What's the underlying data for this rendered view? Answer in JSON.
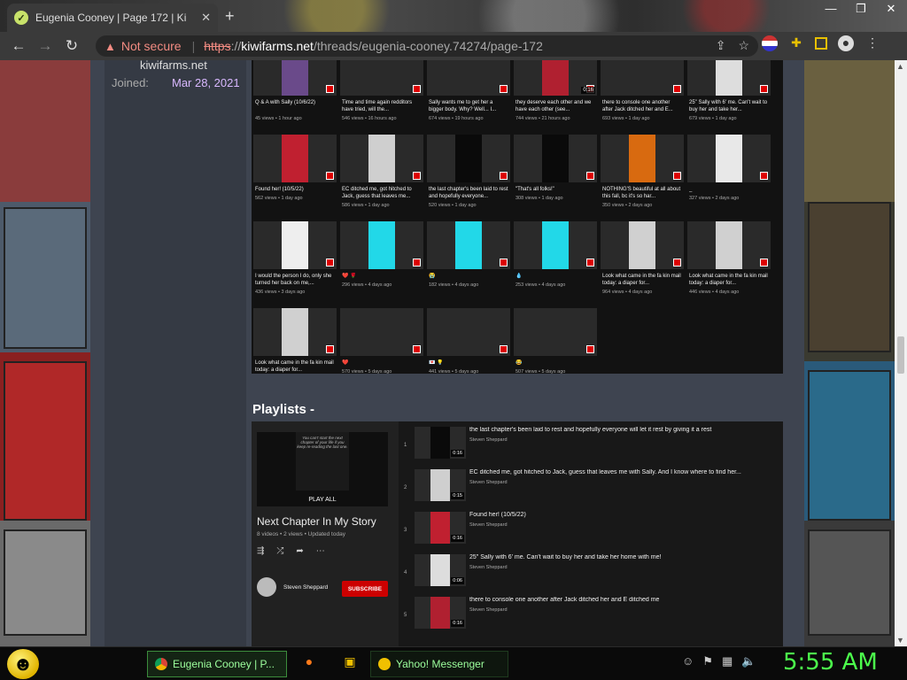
{
  "browser": {
    "tab_title": "Eugenia Cooney | Page 172 | Kiwi",
    "tab_close": "✕",
    "new_tab": "+",
    "window_controls": [
      "—",
      "❐",
      "✕"
    ],
    "nav": {
      "back": "←",
      "forward": "→",
      "reload": "↻"
    },
    "security_label": "Not secure",
    "url_scheme": "https",
    "url_sep": "://",
    "url_host": "kiwifarms.net",
    "url_path": "/threads/eugenia-cooney.74274/page-172"
  },
  "forum": {
    "site_name": "kiwifarms.net",
    "joined_label": "Joined:",
    "joined_date": "Mar 28, 2021"
  },
  "videos": [
    {
      "title": "Q & A with Sally (10/6/22)",
      "meta": "45 views • 1 hour ago",
      "thumb": "#6a4a8a"
    },
    {
      "title": "Time and time again redditors have tried, will the...",
      "meta": "546 views • 16 hours ago",
      "thumb": "#2a2a2a"
    },
    {
      "title": "Sally wants me to get her a bigger body. Why? Well... I...",
      "meta": "674 views • 19 hours ago",
      "thumb": "#2a2a2a"
    },
    {
      "title": "they deserve each other and we have each other (see...",
      "meta": "744 views • 21 hours ago",
      "thumb": "#b02030",
      "dur": "0:16"
    },
    {
      "title": "there to console one another after Jack ditched her and E...",
      "meta": "693 views • 1 day ago",
      "thumb": "#2a2a2a"
    },
    {
      "title": "25\" Sally with 6' me. Can't wait to buy her and take her...",
      "meta": "679 views • 1 day ago",
      "thumb": "#dddddd"
    },
    {
      "title": "Found her! (10/5/22)",
      "meta": "562 views • 1 day ago",
      "thumb": "#c02030"
    },
    {
      "title": "EC ditched me, got hitched to Jack, guess that leaves me...",
      "meta": "586 views • 1 day ago",
      "thumb": "#cfcfcf"
    },
    {
      "title": "the last chapter's been laid to rest and hopefully everyone...",
      "meta": "520 views • 1 day ago",
      "thumb": "#0a0a0a"
    },
    {
      "title": "\"That's all folks!\"",
      "meta": "308 views • 1 day ago",
      "thumb": "#0a0a0a"
    },
    {
      "title": "NOTHING'S beautiful at all about this fall, bc it's so har...",
      "meta": "350 views • 2 days ago",
      "thumb": "#d86a10"
    },
    {
      "title": "_",
      "meta": "327 views • 2 days ago",
      "thumb": "#e8e8e8"
    },
    {
      "title": "I would the person I do, only she turned her back on me,...",
      "meta": "436 views • 3 days ago",
      "thumb": "#eeeeee"
    },
    {
      "title": "❤️ 🌹",
      "meta": "296 views • 4 days ago",
      "thumb": "#22d8e8"
    },
    {
      "title": "😭",
      "meta": "182 views • 4 days ago",
      "thumb": "#22d8e8"
    },
    {
      "title": "💧",
      "meta": "253 views • 4 days ago",
      "thumb": "#22d8e8"
    },
    {
      "title": "Look what came in the fa kin mail today: a diaper for...",
      "meta": "964 views • 4 days ago",
      "thumb": "#d0d0d0"
    },
    {
      "title": "Look what came in the fa kin mail today: a diaper for...",
      "meta": "446 views • 4 days ago",
      "thumb": "#d0d0d0"
    },
    {
      "title": "Look what came in the fa kin mail today: a diaper for...",
      "meta": "487 views • 4 days ago",
      "thumb": "#d0d0d0"
    },
    {
      "title": "❤️",
      "meta": "570 views • 5 days ago",
      "thumb": "#2a2a2a"
    },
    {
      "title": "💌 💡",
      "meta": "441 views • 5 days ago",
      "thumb": "#2a2a2a"
    },
    {
      "title": "😂",
      "meta": "507 views • 5 days ago",
      "thumb": "#2a2a2a"
    }
  ],
  "playlists": {
    "heading": "Playlists -",
    "cover_text": "You can't start the next chapter of your life if you keep re-reading the last one.",
    "play_all": "PLAY ALL",
    "name": "Next Chapter In My Story",
    "meta": "8 videos • 2 views • Updated today",
    "actions": [
      "⇶",
      "⤮",
      "➦",
      "⋯"
    ],
    "channel": "Steven Sheppard",
    "subscribe": "SUBSCRIBE",
    "items": [
      {
        "index": "1",
        "title": "the last chapter's been laid to rest and hopefully everyone will let it rest by giving it a rest",
        "channel": "Steven Sheppard",
        "dur": "0:16",
        "thumb": "#0a0a0a"
      },
      {
        "index": "2",
        "title": "EC ditched me, got hitched to Jack, guess that leaves me with Sally. And I know where to find her...",
        "channel": "Steven Sheppard",
        "dur": "0:15",
        "thumb": "#cfcfcf"
      },
      {
        "index": "3",
        "title": "Found her! (10/5/22)",
        "channel": "Steven Sheppard",
        "dur": "0:16",
        "thumb": "#c02030"
      },
      {
        "index": "4",
        "title": "25\" Sally with 6' me. Can't wait to buy her and take her home with me!",
        "channel": "Steven Sheppard",
        "dur": "0:06",
        "thumb": "#dddddd"
      },
      {
        "index": "5",
        "title": "there to console one another after Jack ditched her and E ditched me",
        "channel": "Steven Sheppard",
        "dur": "0:16",
        "thumb": "#b02030"
      }
    ]
  },
  "taskbar": {
    "tasks": [
      "Eugenia Cooney | P...",
      "Yahoo! Messenger"
    ],
    "clock": "5:55 AM"
  },
  "colors": {
    "accent_green": "#4cff4c",
    "subscribe_red": "#cc0000",
    "insecure_red": "#f28b82"
  }
}
